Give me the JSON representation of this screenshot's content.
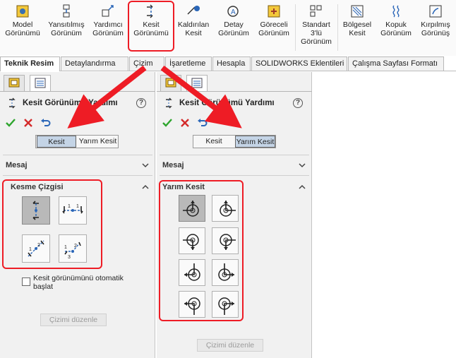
{
  "ribbon": {
    "buttons": [
      {
        "label": "Model\nGörünümü"
      },
      {
        "label": "Yansıtılmış\nGörünüm"
      },
      {
        "label": "Yardımcı\nGörünüm"
      },
      {
        "label": "Kesit\nGörünümü"
      },
      {
        "label": "Kaldırılan\nKesit"
      },
      {
        "label": "Detay\nGörünüm"
      },
      {
        "label": "Göreceli\nGörünüm"
      },
      {
        "label": "Standart\n3'lü\nGörünüm"
      },
      {
        "label": "Bölgesel\nKesit"
      },
      {
        "label": "Kopuk\nGörünüm"
      },
      {
        "label": "Kırpılmış\nGörünüş"
      }
    ]
  },
  "tabs": [
    "Teknik Resim",
    "Detaylandırma",
    "Çizim",
    "İşaretleme",
    "Hesapla",
    "SOLIDWORKS Eklentileri",
    "Çalışma Sayfası Formatı"
  ],
  "left": {
    "title": "Kesit Görünümü Yardımı",
    "help": "?",
    "seg_full": "Kesit",
    "seg_half": "Yarım Kesit",
    "msg_label": "Mesaj",
    "section_label": "Kesme Çizgisi",
    "checkbox_label": "Kesit görünümünü otomatik\nbaşlat",
    "edit_button": "Çizimi düzenle"
  },
  "right": {
    "title": "Kesit Görünümü Yardımı",
    "help": "?",
    "seg_full": "Kesit",
    "seg_half": "Yarım Kesit",
    "msg_label": "Mesaj",
    "section_label": "Yarım Kesit",
    "edit_button": "Çizimi düzenle"
  },
  "colors": {
    "accent_red": "#ee1c25",
    "selected_segment": "#c4d4e6",
    "panel_bg": "#f1f1f1"
  }
}
